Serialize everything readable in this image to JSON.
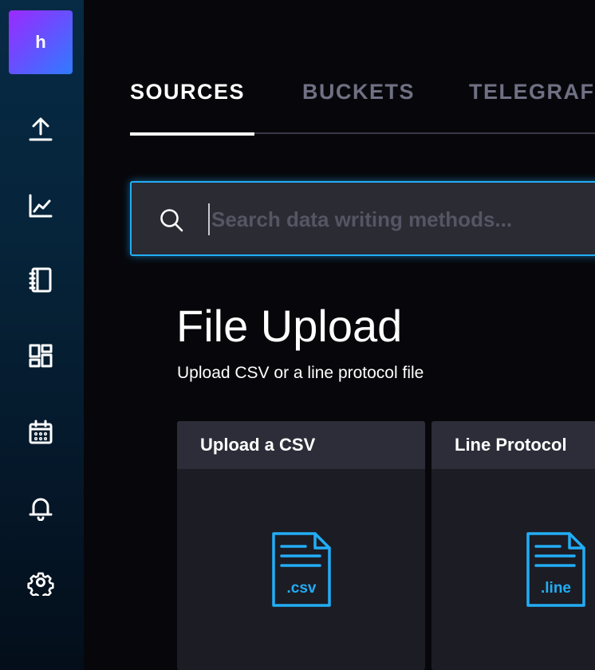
{
  "sidebar": {
    "brand_initial": "h",
    "items": [
      {
        "name": "upload"
      },
      {
        "name": "data-explorer"
      },
      {
        "name": "notebooks"
      },
      {
        "name": "dashboards"
      },
      {
        "name": "tasks"
      },
      {
        "name": "alerts"
      },
      {
        "name": "settings"
      }
    ]
  },
  "tabs": [
    {
      "label": "SOURCES",
      "active": true
    },
    {
      "label": "BUCKETS",
      "active": false
    },
    {
      "label": "TELEGRAF",
      "active": false
    }
  ],
  "search": {
    "placeholder": "Search data writing methods..."
  },
  "section": {
    "title": "File Upload",
    "subtitle": "Upload CSV or a line protocol file"
  },
  "cards": [
    {
      "title": "Upload a CSV",
      "ext": ".csv"
    },
    {
      "title": "Line Protocol",
      "ext": ".line"
    }
  ],
  "colors": {
    "accent": "#22adf6",
    "icon": "#22adf6",
    "background": "#07070b",
    "card": "#1c1c24",
    "card_header": "#2d2d39"
  }
}
